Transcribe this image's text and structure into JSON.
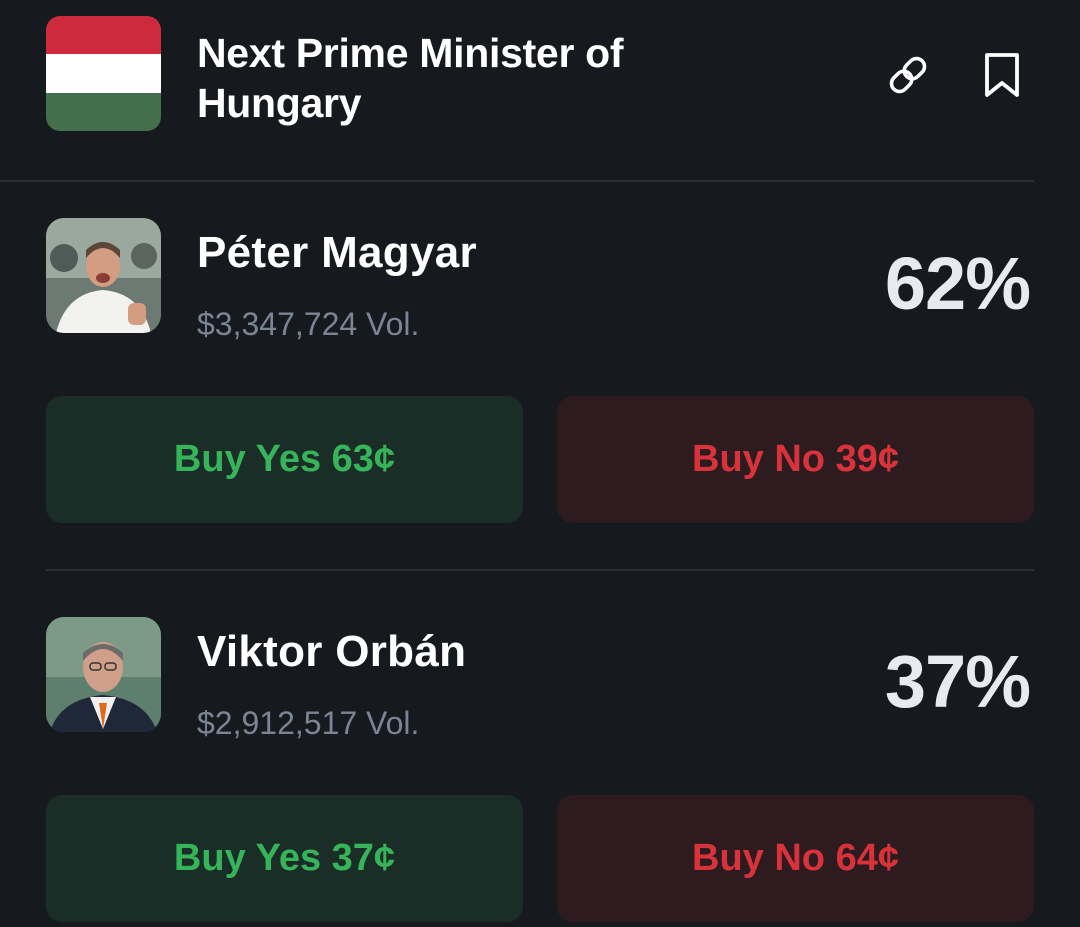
{
  "market": {
    "title": "Next Prime Minister of Hungary",
    "flag_colors": [
      "#cd2a3e",
      "#ffffff",
      "#436f4d"
    ],
    "link_icon": "link-icon",
    "bookmark_icon": "bookmark-icon"
  },
  "colors": {
    "background": "#16191e",
    "yes_text": "#35b45a",
    "yes_bg": "#1b2d27",
    "no_text": "#d8333b",
    "no_bg": "#2d1b1f",
    "muted": "#7b8494"
  },
  "candidates": [
    {
      "name": "Péter Magyar",
      "volume": "$3,347,724 Vol.",
      "percent": "62%",
      "buy_yes": "Buy Yes 63¢",
      "buy_no": "Buy No 39¢"
    },
    {
      "name": "Viktor Orbán",
      "volume": "$2,912,517 Vol.",
      "percent": "37%",
      "buy_yes": "Buy Yes 37¢",
      "buy_no": "Buy No 64¢"
    }
  ]
}
